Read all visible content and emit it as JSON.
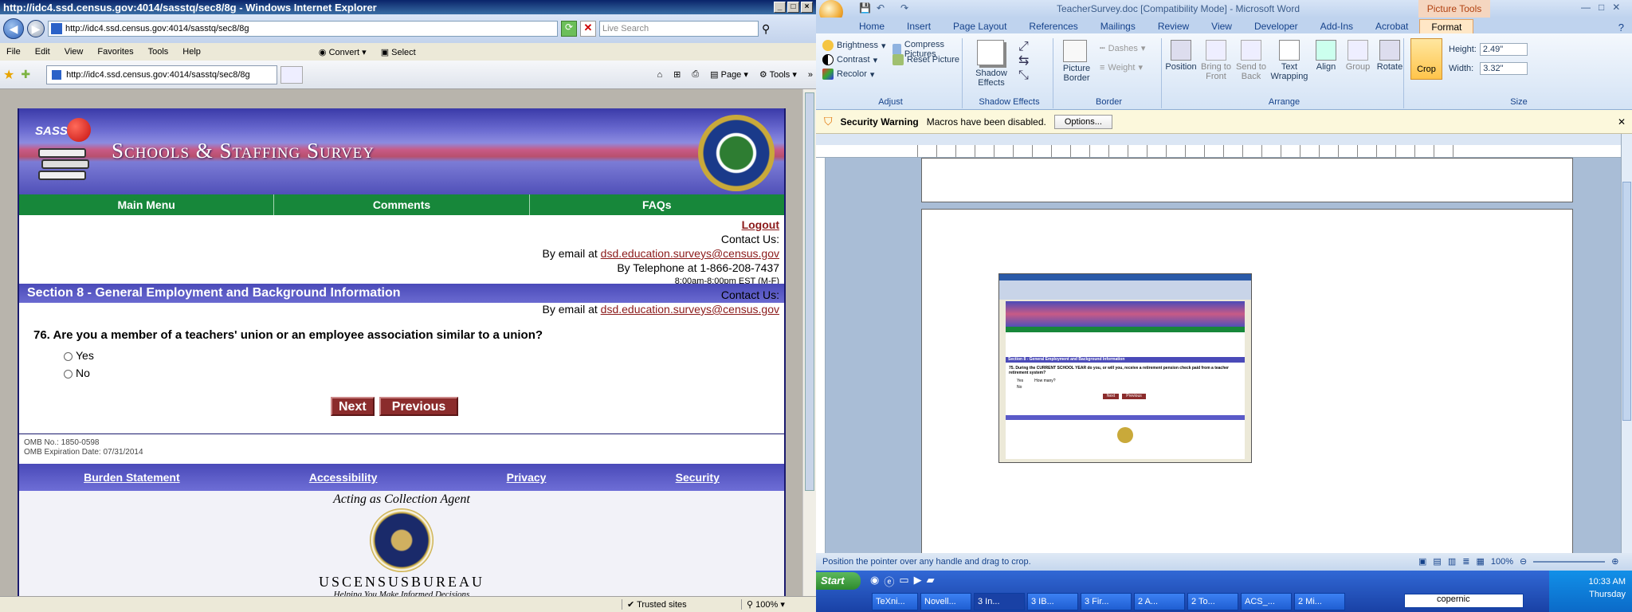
{
  "ie": {
    "title": "http://idc4.ssd.census.gov:4014/sasstq/sec8/8g - Windows Internet Explorer",
    "url": "http://idc4.ssd.census.gov:4014/sasstq/sec8/8g",
    "search_placeholder": "Live Search",
    "menu": [
      "File",
      "Edit",
      "View",
      "Favorites",
      "Tools",
      "Help"
    ],
    "convert_label": "Convert",
    "select_label": "Select",
    "tab_label": "http://idc4.ssd.census.gov:4014/sasstq/sec8/8g",
    "page_label": "Page",
    "tools_label": "Tools",
    "status_zone": "Trusted sites",
    "status_zoom": "100%"
  },
  "page": {
    "banner_logo_text": "SASS",
    "banner_title": "Schools & Staffing Survey",
    "nav": [
      "Main Menu",
      "Comments",
      "FAQs"
    ],
    "logout": "Logout",
    "contact_us": "Contact Us:",
    "email_prefix": "By email at",
    "email": "dsd.education.surveys@census.gov",
    "phone": "By Telephone at 1-866-208-7437",
    "hours": "8:00am-8:00pm EST (M-F)",
    "section_title": "Section 8 - General Employment and Background Information",
    "question": "76. Are you a member of a teachers' union or an employee association similar to a union?",
    "options": [
      "Yes",
      "No"
    ],
    "next_label": "Next",
    "previous_label": "Previous",
    "omb_no": "OMB No.: 1850-0598",
    "omb_exp": "OMB Expiration Date: 07/31/2014",
    "footer_links": [
      "Burden Statement",
      "Accessibility",
      "Privacy",
      "Security"
    ],
    "agent_text": "Acting as Collection Agent",
    "bureau": "USCENSUSBUREAU",
    "bureau_tagline": "Helping You Make Informed Decisions"
  },
  "word": {
    "title": "TeacherSurvey.doc [Compatibility Mode] - Microsoft Word",
    "context_tab": "Picture Tools",
    "tabs": [
      "Home",
      "Insert",
      "Page Layout",
      "References",
      "Mailings",
      "Review",
      "View",
      "Developer",
      "Add-Ins",
      "Acrobat",
      "Format"
    ],
    "adjust": {
      "brightness": "Brightness",
      "contrast": "Contrast",
      "recolor": "Recolor",
      "compress": "Compress Pictures",
      "reset": "Reset Picture",
      "label": "Adjust"
    },
    "shadow": {
      "button": "Shadow Effects",
      "label": "Shadow Effects"
    },
    "border": {
      "picture_border": "Picture Border",
      "dashes": "Dashes",
      "weight": "Weight",
      "label": "Border"
    },
    "arrange": {
      "items": [
        "Position",
        "Bring to Front",
        "Send to Back",
        "Text Wrapping",
        "Align",
        "Group",
        "Rotate"
      ],
      "label": "Arrange"
    },
    "size": {
      "crop": "Crop",
      "height_label": "Height:",
      "height": "2.49\"",
      "width_label": "Width:",
      "width": "3.32\"",
      "label": "Size"
    },
    "security_title": "Security Warning",
    "security_msg": "Macros have been disabled.",
    "options_btn": "Options...",
    "status": "Position the pointer over any handle and drag to crop.",
    "zoom": "100%"
  },
  "taskbar": {
    "start": "Start",
    "tasks": [
      "TeXni...",
      "Novell...",
      "3 In...",
      "3 IB...",
      "3 Fir...",
      "2 A...",
      "2 To...",
      "ACS_...",
      "2 Mi..."
    ],
    "search_value": "copernic",
    "time": "10:33 AM",
    "day": "Thursday"
  },
  "thumb": {
    "section": "Section 8 - General Employment and Background Information",
    "question": "75. During the CURRENT SCHOOL YEAR do you, or will you, receive a retirement pension check paid from a teacher retirement system?",
    "yes": "Yes",
    "how_many": "How many?",
    "no": "No",
    "next": "Next",
    "previous": "Previous"
  },
  "colors": {
    "nav_green": "#17873a",
    "section_blue": "#4a4ab8",
    "button_red": "#8b2c2c",
    "link_red": "#8b1a1a"
  }
}
